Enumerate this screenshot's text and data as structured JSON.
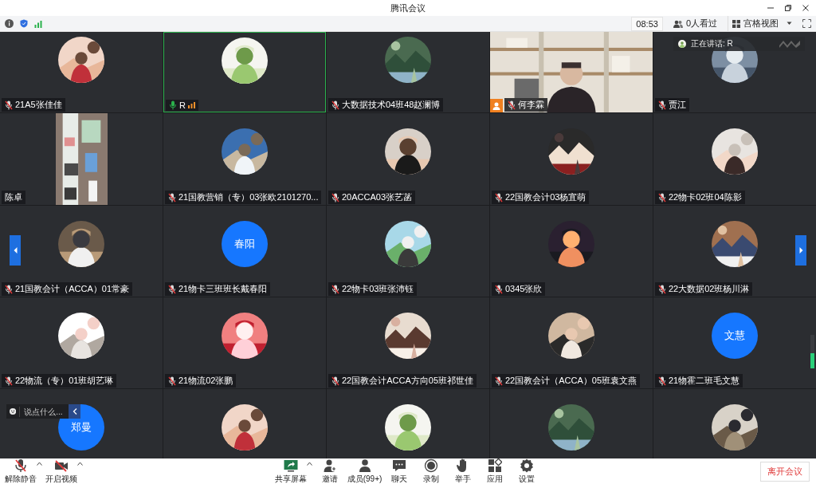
{
  "window": {
    "title": "腾讯会议"
  },
  "info_bar": {
    "time": "08:53",
    "viewers": "0人看过",
    "view_mode": "宫格视图"
  },
  "tiles": [
    {
      "kind": "avatar",
      "name": "21A5张佳佳",
      "muted": true,
      "speaking": false,
      "host": false
    },
    {
      "kind": "avatar",
      "name": "R",
      "muted": false,
      "speaking": true,
      "host": false
    },
    {
      "kind": "avatar",
      "name": "大数据技术04班48赵澜博",
      "muted": true,
      "speaking": false,
      "host": false
    },
    {
      "kind": "video",
      "name": "何李霖",
      "muted": true,
      "speaking": false,
      "host": true
    },
    {
      "kind": "avatar",
      "name": "贾江",
      "muted": true,
      "speaking": false,
      "host": false
    },
    {
      "kind": "portrait",
      "name": "陈卓",
      "speaking": false,
      "host": false
    },
    {
      "kind": "avatar",
      "name": "21国教营销（专）03张欧2101270...",
      "muted": true,
      "speaking": false,
      "host": false
    },
    {
      "kind": "avatar",
      "name": "20ACCA03张艺菡",
      "muted": true,
      "speaking": false,
      "host": false
    },
    {
      "kind": "avatar",
      "name": "22国教会计03杨宜萌",
      "muted": true,
      "speaking": false,
      "host": false
    },
    {
      "kind": "avatar",
      "name": "22物卡02班04陈影",
      "muted": true,
      "speaking": false,
      "host": false
    },
    {
      "kind": "avatar",
      "name": "21国教会计（ACCA）01常豪",
      "muted": true,
      "speaking": false,
      "host": false
    },
    {
      "kind": "initials",
      "initials": "春阳",
      "name": "21物卡三班班长戴春阳",
      "muted": true,
      "speaking": false,
      "host": false
    },
    {
      "kind": "avatar",
      "name": "22物卡03班张沛钰",
      "muted": true,
      "speaking": false,
      "host": false
    },
    {
      "kind": "avatar",
      "name": "0345张欣",
      "muted": true,
      "speaking": false,
      "host": false
    },
    {
      "kind": "avatar",
      "name": "22大数据02班杨川淋",
      "muted": true,
      "speaking": false,
      "host": false
    },
    {
      "kind": "avatar",
      "name": "22物流（专）01班胡艺琳",
      "muted": true,
      "speaking": false,
      "host": false
    },
    {
      "kind": "avatar",
      "name": "21物流02张鹏",
      "muted": true,
      "speaking": false,
      "host": false
    },
    {
      "kind": "avatar",
      "name": "22国教会计ACCA方向05班祁世佳",
      "muted": true,
      "speaking": false,
      "host": false
    },
    {
      "kind": "avatar",
      "name": "22国教会计（ACCA）05班袁文燕",
      "muted": true,
      "speaking": false,
      "host": false
    },
    {
      "kind": "initials",
      "initials": "文慧",
      "name": "21物霍二班毛文慧",
      "muted": true,
      "speaking": false,
      "host": false
    },
    {
      "kind": "initials",
      "initials": "郑曼",
      "speaking": false
    },
    {
      "kind": "avatar",
      "speaking": false
    },
    {
      "kind": "avatar",
      "speaking": false
    },
    {
      "kind": "avatar",
      "speaking": false
    },
    {
      "kind": "avatar",
      "speaking": false
    }
  ],
  "speaking_banner": {
    "text": "正在讲话: R"
  },
  "chat": {
    "placeholder": "说点什么..."
  },
  "meter": {
    "level": 0.45
  },
  "toolbar": {
    "left": [
      {
        "label": "解除静音",
        "has_menu": true
      },
      {
        "label": "开启视频",
        "has_menu": true
      }
    ],
    "center": [
      {
        "label": "共享屏幕",
        "has_menu": true
      },
      {
        "label": "邀请",
        "has_menu": false
      },
      {
        "label": "成员(99+)",
        "has_menu": false
      },
      {
        "label": "聊天",
        "has_menu": false
      },
      {
        "label": "录制",
        "has_menu": false
      },
      {
        "label": "举手",
        "has_menu": false
      },
      {
        "label": "应用",
        "has_menu": false
      },
      {
        "label": "设置",
        "has_menu": false
      }
    ],
    "leave": "离开会议"
  }
}
